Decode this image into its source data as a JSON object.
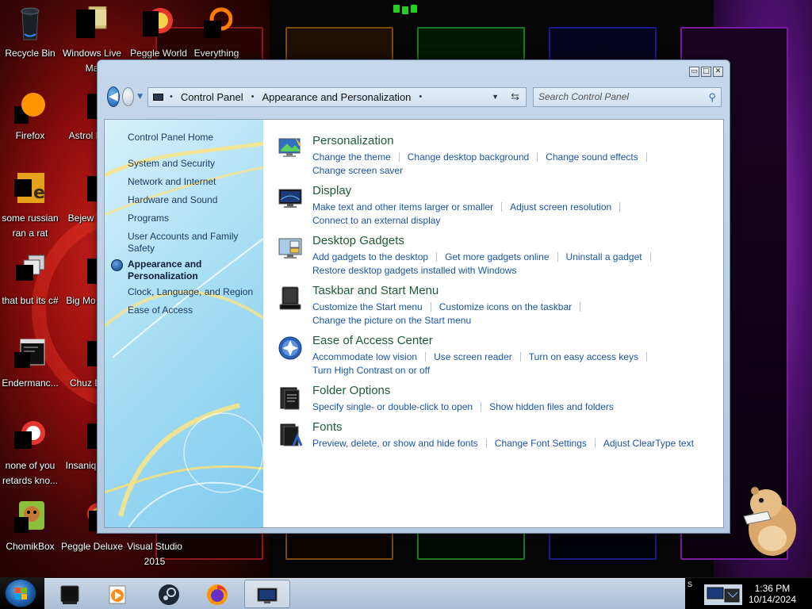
{
  "desktop": {
    "icons": [
      {
        "label": "Recycle Bin"
      },
      {
        "label": "Windows Live Ma"
      },
      {
        "label": "Peggle World"
      },
      {
        "label": "Everything"
      },
      {
        "label": "Firefox"
      },
      {
        "label": "Astrol Delu"
      },
      {
        "label": "some russian ran a rat"
      },
      {
        "label": "Bejew Delu"
      },
      {
        "label": "that but its c#"
      },
      {
        "label": "Big Mo Delu"
      },
      {
        "label": "Endermanc..."
      },
      {
        "label": "Chuz Delu"
      },
      {
        "label": "none of you retards kno..."
      },
      {
        "label": "Insaniq Delu"
      },
      {
        "label": "ChomikBox"
      },
      {
        "label": "Peggle Deluxe"
      },
      {
        "label": "Visual Studio 2015"
      }
    ]
  },
  "window": {
    "controls": {
      "minimize": "▭",
      "maximize": "□",
      "close": "✕"
    },
    "address": {
      "crumbs": [
        "Control Panel",
        "Appearance and Personalization"
      ],
      "separator": "•"
    },
    "search": {
      "placeholder": "Search Control Panel"
    },
    "nav_pane": {
      "home": "Control Panel Home",
      "items": [
        "System and Security",
        "Network and Internet",
        "Hardware and Sound",
        "Programs",
        "User Accounts and Family Safety",
        "Appearance and Personalization",
        "Clock, Language, and Region",
        "Ease of Access"
      ],
      "current_index": 5
    },
    "categories": [
      {
        "title": "Personalization",
        "icon": "personalization-icon",
        "links": [
          "Change the theme",
          "Change desktop background",
          "Change sound effects",
          "Change screen saver"
        ]
      },
      {
        "title": "Display",
        "icon": "display-icon",
        "links": [
          "Make text and other items larger or smaller",
          "Adjust screen resolution",
          "Connect to an external display"
        ]
      },
      {
        "title": "Desktop Gadgets",
        "icon": "gadgets-icon",
        "links": [
          "Add gadgets to the desktop",
          "Get more gadgets online",
          "Uninstall a gadget",
          "Restore desktop gadgets installed with Windows"
        ]
      },
      {
        "title": "Taskbar and Start Menu",
        "icon": "taskbar-icon",
        "links": [
          "Customize the Start menu",
          "Customize icons on the taskbar",
          "Change the picture on the Start menu"
        ]
      },
      {
        "title": "Ease of Access Center",
        "icon": "ease-of-access-icon",
        "links": [
          "Accommodate low vision",
          "Use screen reader",
          "Turn on easy access keys",
          "Turn High Contrast on or off"
        ]
      },
      {
        "title": "Folder Options",
        "icon": "folder-options-icon",
        "links": [
          "Specify single- or double-click to open",
          "Show hidden files and folders"
        ]
      },
      {
        "title": "Fonts",
        "icon": "fonts-icon",
        "links": [
          "Preview, delete, or show and hide fonts",
          "Change Font Settings",
          "Adjust ClearType text"
        ]
      }
    ]
  },
  "taskbar": {
    "items": [
      "terminal-app-icon",
      "media-player-icon",
      "steam-icon",
      "firefox-icon",
      "control-panel-icon"
    ],
    "active_index": 4,
    "tray_letter": "S",
    "clock": {
      "time": "1:36 PM",
      "date": "10/14/2024"
    }
  },
  "colors": {
    "link": "#1a56a4",
    "category_title": "#1e5b3a",
    "nav_link": "#1f3a66"
  }
}
